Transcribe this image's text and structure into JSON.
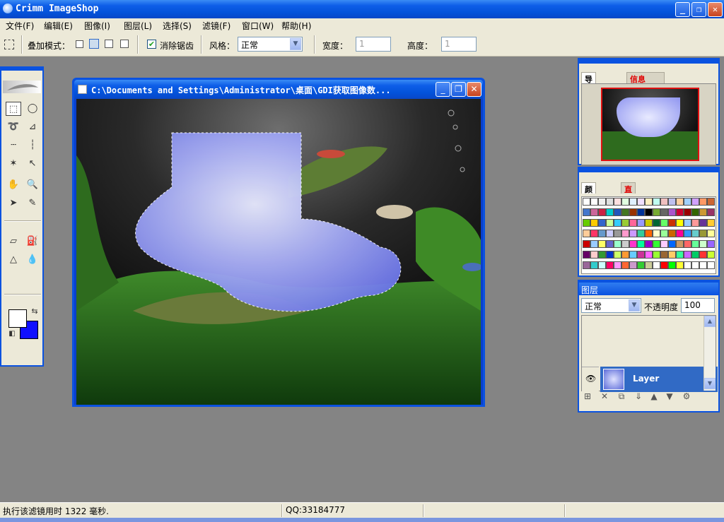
{
  "app": {
    "title": "Crimm ImageShop",
    "controls": {
      "minimize": "_",
      "maximize": "❐",
      "close": "✕"
    }
  },
  "menu": [
    "文件(F)",
    "编辑(E)",
    "图像(I)",
    "图层(L)",
    "选择(S)",
    "滤镜(F)",
    "窗口(W)",
    "帮助(H)"
  ],
  "options": {
    "blend_mode_label": "叠加模式：",
    "antialias_label": "消除锯齿",
    "antialias_checked": true,
    "style_label": "风格：",
    "style_value": "正常",
    "width_label": "宽度：",
    "width_value": "1",
    "height_label": "高度：",
    "height_value": "1"
  },
  "document": {
    "title": "C:\\Documents and Settings\\Administrator\\桌面\\GDI获取图像数..."
  },
  "navigator": {
    "tabs": [
      "导航器",
      "信息"
    ]
  },
  "color_panel": {
    "tabs": [
      "颜色",
      "直方图"
    ],
    "swatches": [
      "#ffffff",
      "#ffffff",
      "#f0f0f0",
      "#e0e0e0",
      "#ffe0e0",
      "#e0ffe0",
      "#e0f0ff",
      "#f0e0ff",
      "#fff0c0",
      "#c0fff0",
      "#f0c0c0",
      "#c0c0f0",
      "#ffd0a0",
      "#a0d0ff",
      "#d0a0ff",
      "#ff9966",
      "#cc6633",
      "#4477cc",
      "#cc6699",
      "#cc2244",
      "#00cccc",
      "#2255bb",
      "#447722",
      "#993300",
      "#003399",
      "#000000",
      "#77aa33",
      "#666666",
      "#aa55cc",
      "#cc0033",
      "#990000",
      "#336600",
      "#cc9933",
      "#993366",
      "#66cc00",
      "#ffcc00",
      "#3366cc",
      "#ccff99",
      "#33ccff",
      "#99cc33",
      "#ff6699",
      "#9999ff",
      "#cccc00",
      "#006633",
      "#66ff66",
      "#cc3300",
      "#ffff00",
      "#99ccff",
      "#ff9999",
      "#663399",
      "#ffcc33",
      "#ffcc99",
      "#ff3366",
      "#6699cc",
      "#ccccff",
      "#999999",
      "#ff99cc",
      "#cc99ff",
      "#33cc99",
      "#ff6600",
      "#ffffcc",
      "#99ff99",
      "#cc6600",
      "#ff0099",
      "#3399ff",
      "#66cccc",
      "#999933",
      "#ffff99",
      "#cc0000",
      "#99ccff",
      "#ffff66",
      "#6666cc",
      "#99ffcc",
      "#cccccc",
      "#ff33cc",
      "#00ff99",
      "#9900cc",
      "#33ff33",
      "#ffccff",
      "#0066ff",
      "#cc9966",
      "#ff6666",
      "#66ff99",
      "#ccffcc",
      "#9966ff",
      "#660066",
      "#ffcccc",
      "#339933",
      "#0033cc",
      "#ccff66",
      "#ff9933",
      "#66ccff",
      "#cc3399",
      "#ff66ff",
      "#99ff33",
      "#996633",
      "#ffcc66",
      "#33ff99",
      "#cc66ff",
      "#00cc66",
      "#ff3333",
      "#ccff33",
      "#996699",
      "#33cccc",
      "#ccffff",
      "#ff0066",
      "#ff99ff",
      "#ff6633",
      "#cc99cc",
      "#33cc33",
      "#cccc99",
      "#ffffff",
      "#ff0000",
      "#00ff00",
      "#ffff33",
      "#ffffff",
      "#ffffff",
      "#ffffff",
      "#ffffff"
    ]
  },
  "layers": {
    "title": "图层",
    "blend": "正常",
    "opacity_label": "不透明度",
    "opacity_value": "100",
    "layer_name": "Layer"
  },
  "status": {
    "message": "执行该滤镜用时 1322 毫秒.",
    "contact": "QQ:33184777"
  }
}
